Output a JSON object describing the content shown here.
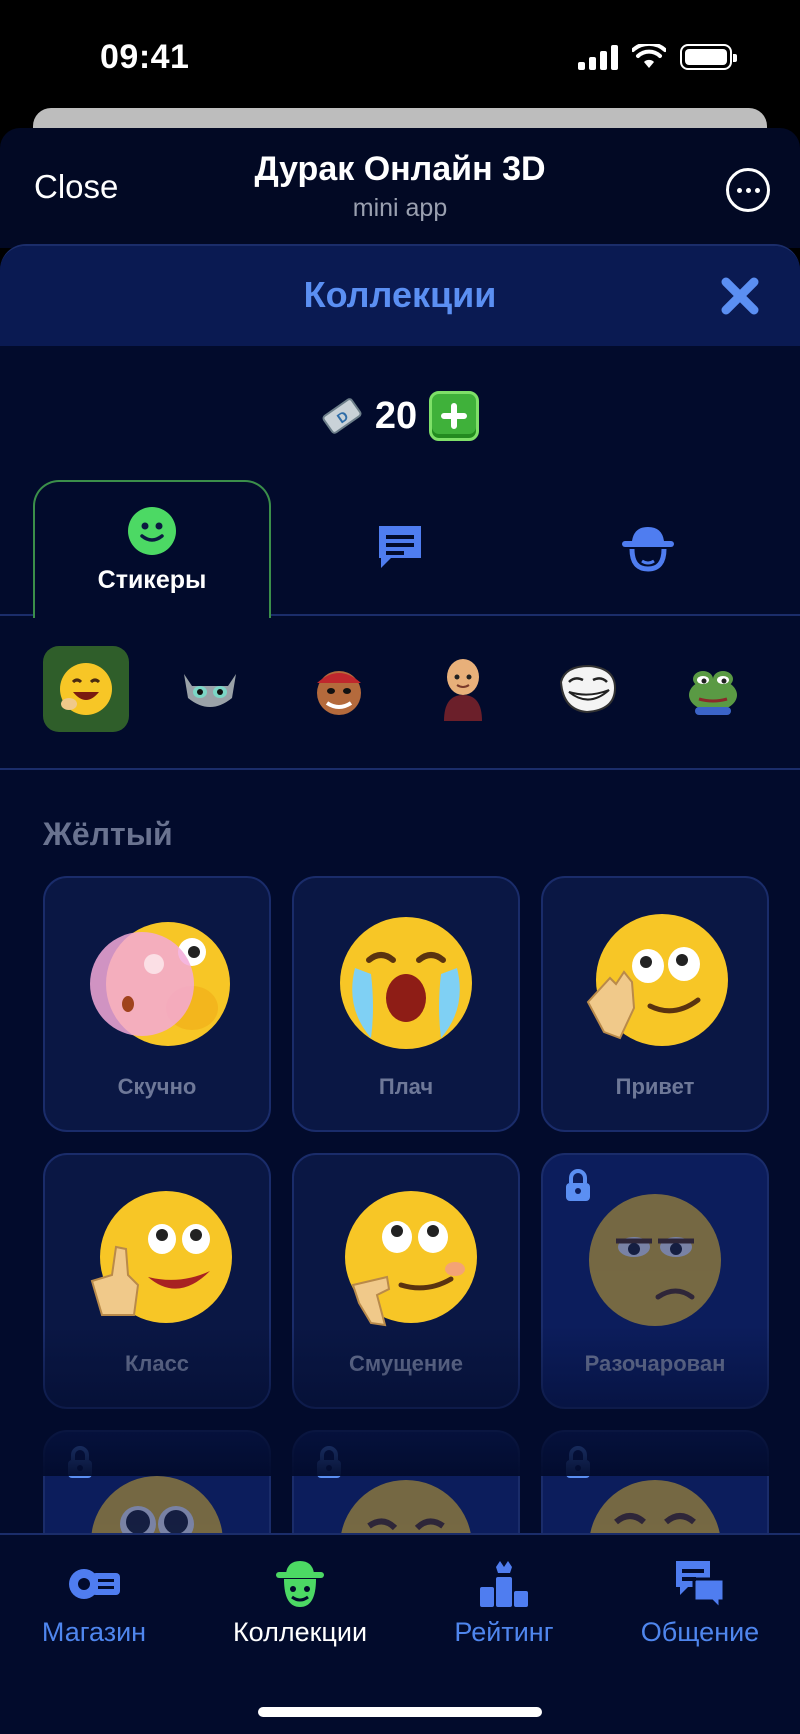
{
  "status_bar": {
    "time": "09:41"
  },
  "telegram": {
    "close_label": "Close",
    "title": "Дурак Онлайн 3D",
    "subtitle": "mini app"
  },
  "app": {
    "title": "Коллекции",
    "currency": {
      "value": "20",
      "icon": "ticket-icon"
    }
  },
  "tabs": [
    {
      "label": "Стикеры",
      "icon": "smiley-icon",
      "active": true
    },
    {
      "label": "",
      "icon": "chat-bubble-icon",
      "active": false
    },
    {
      "label": "",
      "icon": "hat-mask-icon",
      "active": false
    }
  ],
  "sticker_packs": [
    {
      "name": "yellow-emoji-pack",
      "active": true
    },
    {
      "name": "cat-pack",
      "active": false
    },
    {
      "name": "pirate-pack",
      "active": false
    },
    {
      "name": "man-pack",
      "active": false
    },
    {
      "name": "trollface-pack",
      "active": false
    },
    {
      "name": "pepe-pack",
      "active": false
    }
  ],
  "section": {
    "title": "Жёлтый"
  },
  "stickers": [
    {
      "label": "Скучно",
      "locked": false
    },
    {
      "label": "Плач",
      "locked": false
    },
    {
      "label": "Привет",
      "locked": false
    },
    {
      "label": "Класс",
      "locked": false
    },
    {
      "label": "Смущение",
      "locked": false
    },
    {
      "label": "Разочарован",
      "locked": true
    },
    {
      "label": "",
      "locked": true
    },
    {
      "label": "",
      "locked": true
    },
    {
      "label": "",
      "locked": true
    }
  ],
  "bottom_nav": [
    {
      "label": "Магазин",
      "icon": "shop-icon",
      "active": false
    },
    {
      "label": "Коллекции",
      "icon": "collections-hat-icon",
      "active": true
    },
    {
      "label": "Рейтинг",
      "icon": "podium-icon",
      "active": false
    },
    {
      "label": "Общение",
      "icon": "chat-icon",
      "active": false
    }
  ],
  "colors": {
    "accent_blue": "#5b8ff2",
    "accent_green": "#3fb13a",
    "background": "#020b2c",
    "card": "#0a1744"
  }
}
